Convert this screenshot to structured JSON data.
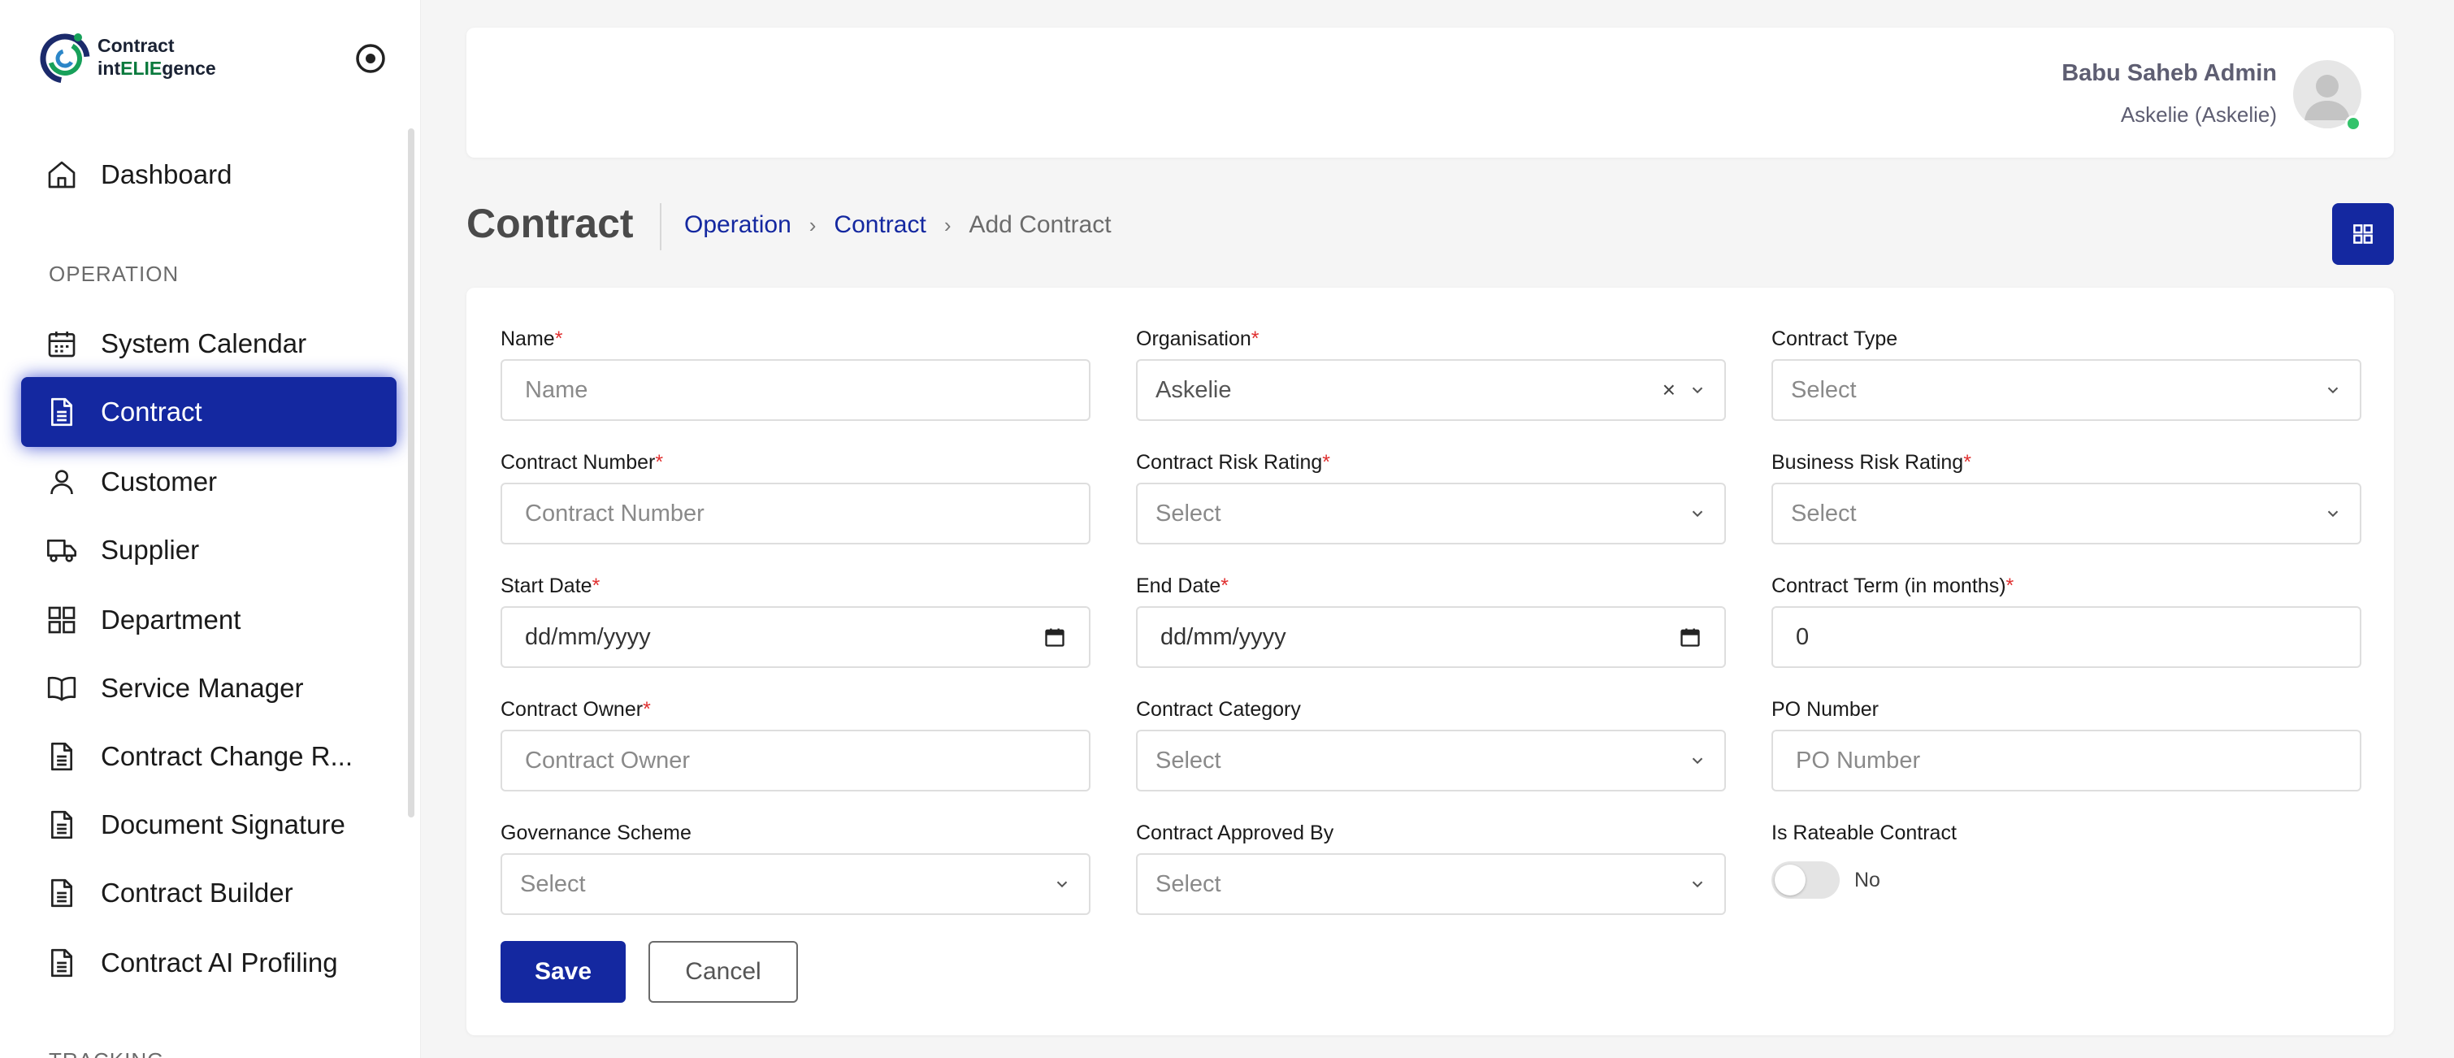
{
  "brand": {
    "line1": "Contract",
    "line2_prefix": "int",
    "line2_accent": "ELIE",
    "line2_suffix": "gence",
    "logo_icon": "contract-intelligence-logo"
  },
  "sidebar": {
    "items": [
      {
        "label": "Dashboard",
        "icon": "home-icon"
      },
      {
        "label": "System Calendar",
        "icon": "calendar-icon"
      },
      {
        "label": "Contract",
        "icon": "document-icon",
        "active": true
      },
      {
        "label": "Customer",
        "icon": "user-icon"
      },
      {
        "label": "Supplier",
        "icon": "truck-icon"
      },
      {
        "label": "Department",
        "icon": "grid-icon"
      },
      {
        "label": "Service Manager",
        "icon": "book-icon"
      },
      {
        "label": "Contract Change R...",
        "icon": "document-icon"
      },
      {
        "label": "Document Signature",
        "icon": "document-icon"
      },
      {
        "label": "Contract Builder",
        "icon": "document-icon"
      },
      {
        "label": "Contract AI Profiling",
        "icon": "document-icon"
      }
    ],
    "sections": {
      "operation": "OPERATION",
      "tracking": "TRACKING"
    }
  },
  "header": {
    "user_name": "Babu Saheb Admin",
    "user_org": "Askelie (Askelie)"
  },
  "page": {
    "title": "Contract",
    "breadcrumb": [
      "Operation",
      "Contract",
      "Add Contract"
    ]
  },
  "form": {
    "name": {
      "label": "Name",
      "placeholder": "Name"
    },
    "organisation": {
      "label": "Organisation",
      "value": "Askelie"
    },
    "contract_type": {
      "label": "Contract Type",
      "value": "Select"
    },
    "contract_number": {
      "label": "Contract Number",
      "placeholder": "Contract Number"
    },
    "contract_risk_rating": {
      "label": "Contract Risk Rating",
      "value": "Select"
    },
    "business_risk_rating": {
      "label": "Business Risk Rating",
      "value": "Select"
    },
    "start_date": {
      "label": "Start Date",
      "value": "dd/mm/yyyy"
    },
    "end_date": {
      "label": "End Date",
      "value": "dd/mm/yyyy"
    },
    "contract_term": {
      "label": "Contract Term (in months)",
      "value": "0"
    },
    "contract_owner": {
      "label": "Contract Owner",
      "placeholder": "Contract Owner"
    },
    "contract_category": {
      "label": "Contract Category",
      "value": "Select"
    },
    "po_number": {
      "label": "PO Number",
      "placeholder": "PO Number"
    },
    "governance_scheme": {
      "label": "Governance Scheme",
      "value": "Select"
    },
    "contract_approved_by": {
      "label": "Contract Approved By",
      "value": "Select"
    },
    "is_rateable": {
      "label": "Is Rateable Contract",
      "state": "No"
    },
    "required_mark": "*",
    "clear_glyph": "×"
  },
  "actions": {
    "save": "Save",
    "cancel": "Cancel"
  },
  "colors": {
    "primary": "#1428a0",
    "required": "#e03030",
    "online": "#33c36b",
    "logo_green": "#0a7a3d"
  }
}
